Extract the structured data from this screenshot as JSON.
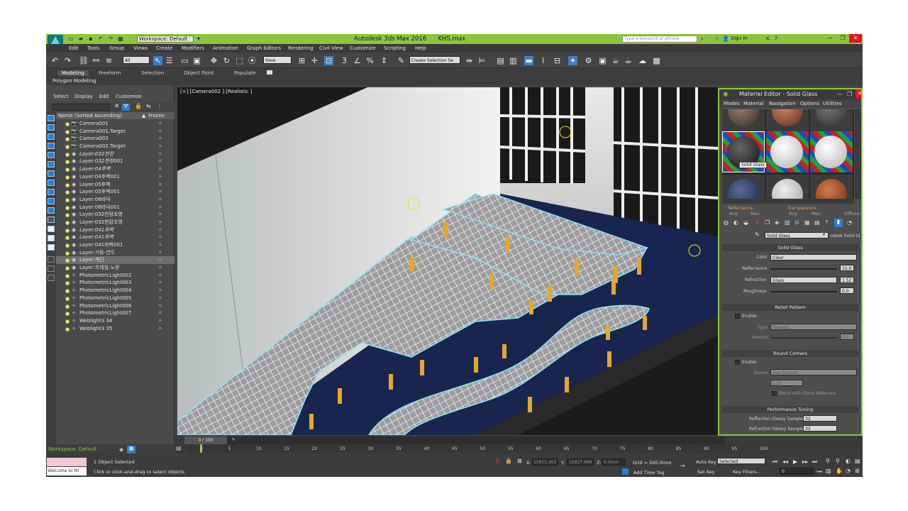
{
  "window": {
    "title": "Autodesk 3ds Max 2016",
    "file": "KHS.max",
    "workspace": "Workspace: Default",
    "search_placeholder": "Type a keyword or phrase",
    "sign_in": "Sign In",
    "logo_text": "MAX"
  },
  "menu": [
    "Edit",
    "Tools",
    "Group",
    "Views",
    "Create",
    "Modifiers",
    "Animation",
    "Graph Editors",
    "Rendering",
    "Civil View",
    "Customize",
    "Scripting",
    "Help"
  ],
  "toolbar": {
    "selection_filter": "All",
    "ref_coord": "View",
    "named_selection": "Create Selection Se"
  },
  "ribbon": {
    "tabs": [
      "Modeling",
      "Freeform",
      "Selection",
      "Object Paint",
      "Populate"
    ],
    "active_tab": "Modeling",
    "panel": "Polygon Modeling"
  },
  "explorer": {
    "menus": [
      "Select",
      "Display",
      "Edit",
      "Customize"
    ],
    "col_name": "Name (Sorted Ascending)",
    "col_frozen": "Frozen",
    "rows": [
      {
        "name": "Camera001",
        "kind": "camera"
      },
      {
        "name": "Camera001.Target",
        "kind": "camera"
      },
      {
        "name": "Camera002",
        "kind": "camera"
      },
      {
        "name": "Camera002.Target",
        "kind": "camera"
      },
      {
        "name": "Layer:032천장",
        "kind": "layer",
        "italic": true
      },
      {
        "name": "Layer:032천장001",
        "kind": "layer",
        "italic": true
      },
      {
        "name": "Layer:04후벽",
        "kind": "layer",
        "italic": true
      },
      {
        "name": "Layer:04후벽001",
        "kind": "layer"
      },
      {
        "name": "Layer:05후벽",
        "kind": "layer"
      },
      {
        "name": "Layer:05후벽001",
        "kind": "layer"
      },
      {
        "name": "Layer:06바닥",
        "kind": "layer"
      },
      {
        "name": "Layer:06바닥001",
        "kind": "layer"
      },
      {
        "name": "Layer:032천장조명",
        "kind": "layer"
      },
      {
        "name": "Layer:032천장조명",
        "kind": "layer"
      },
      {
        "name": "Layer:041좌벽",
        "kind": "layer",
        "italic": true
      },
      {
        "name": "Layer:041좌벽",
        "kind": "layer",
        "italic": true
      },
      {
        "name": "Layer:041좌벽001",
        "kind": "layer"
      },
      {
        "name": "Layer:기둥-연두",
        "kind": "layer"
      },
      {
        "name": "Layer:계단",
        "kind": "layer",
        "highlight": true
      },
      {
        "name": "Layer:프레임-노랑",
        "kind": "layer"
      },
      {
        "name": "PhotometricLight002",
        "kind": "light"
      },
      {
        "name": "PhotometricLight003",
        "kind": "light"
      },
      {
        "name": "PhotometricLight004",
        "kind": "light"
      },
      {
        "name": "PhotometricLight005",
        "kind": "light"
      },
      {
        "name": "PhotometricLight006",
        "kind": "light"
      },
      {
        "name": "PhotometricLight007",
        "kind": "light"
      },
      {
        "name": "Weblight3 34",
        "kind": "light"
      },
      {
        "name": "Weblight3 35",
        "kind": "light"
      }
    ]
  },
  "viewport": {
    "label": "[+] [Camera002 ] [Realistic ]"
  },
  "material_editor": {
    "title": "Material Editor - Solid Glass",
    "menus": [
      "Modes",
      "Material",
      "Navigation",
      "Options",
      "Utilities"
    ],
    "tooltip": "Solid Glass",
    "mini_labels": {
      "reflectance": "Reflectance",
      "transparence": "Transparence",
      "avg": "Avg:",
      "max": "Max:",
      "diffuse": "Diffuse:"
    },
    "material_name": "Solid Glass",
    "material_type": "odesk Solid Gl",
    "sections": {
      "solid_glass": "Solid Glass",
      "relief": "Relief Pattern",
      "round": "Round Corners",
      "perf": "Performance Tuning"
    },
    "solid_glass": {
      "color_label": "Color",
      "color_value": "Clear",
      "reflectance_label": "Reflectance",
      "reflectance_value": "15.0",
      "refraction_label": "Refraction",
      "refraction_type": "Glass",
      "refraction_value": "1.52",
      "roughness_label": "Roughness",
      "roughness_value": "0.0"
    },
    "relief": {
      "enable": "Enable",
      "type_label": "Type",
      "type_value": "Rippled",
      "amount_label": "Amount",
      "amount_value": "0.5"
    },
    "round": {
      "enable": "Enable",
      "source_label": "Source",
      "source_value": "Use Spinner",
      "radius_value": "0.25",
      "blend": "Blend with Other Materials"
    },
    "perf": {
      "refl_label": "Reflection Glossy Samples",
      "refl_value": "32",
      "refr_label": "Refraction Glossy Samples",
      "refr_value": "32"
    }
  },
  "timeline": {
    "frame": "0 / 100",
    "ticks": [
      "0",
      "5",
      "10",
      "15",
      "20",
      "25",
      "30",
      "35",
      "40",
      "45",
      "50",
      "55",
      "60",
      "65",
      "70",
      "75",
      "80",
      "85",
      "90",
      "95",
      "100"
    ]
  },
  "status": {
    "workspace": "Workspace: Default",
    "maxscript_prompt": "Welcome to M/",
    "selected": "1 Object Selected",
    "hint": "Click or click-and-drag to select objects",
    "x": "15815.362",
    "y": "16927.969",
    "z": "0.0mm",
    "grid": "Grid = 500.0mm",
    "add_time_tag": "Add Time Tag",
    "auto_key": "Auto Key",
    "set_key": "Set Key",
    "key_filter_value": "Selected",
    "key_filters": "Key Filters...",
    "frame_value": "0",
    "x_label": "X:",
    "y_label": "Y:",
    "z_label": "Z:"
  }
}
